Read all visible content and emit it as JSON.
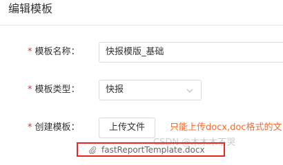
{
  "dialog": {
    "title": "编辑模板"
  },
  "form": {
    "required_mark": "*",
    "template_name": {
      "label": "模板名称：",
      "value": "快报模版_基础"
    },
    "template_type": {
      "label": "模板类型：",
      "selected": "快报"
    },
    "create_template": {
      "label": "创建模板：",
      "upload_button": "上传文件",
      "hint": "只能上传docx,doc格式的文",
      "file_name": "fastReportTemplate.docx"
    }
  },
  "watermark": "CSDN @木木木不哭",
  "icons": {
    "select_arrow": "chevron-down-icon",
    "attachment": "paperclip-icon"
  },
  "colors": {
    "required": "#f5222d",
    "hint": "#fa6b2c",
    "highlight_border": "#f02020"
  }
}
